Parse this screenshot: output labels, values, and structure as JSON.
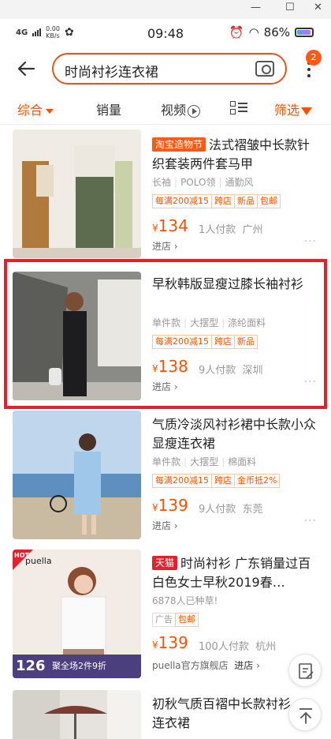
{
  "window_controls": {
    "minimize": "—",
    "maximize": "☐",
    "close": "✕"
  },
  "status_bar": {
    "signal": "4G",
    "net_speed_value": "0.00",
    "net_speed_unit": "KB/s",
    "time": "09:48",
    "battery_percent": "86%"
  },
  "search": {
    "query": "时尚衬衫连衣裙",
    "badge_count": "2"
  },
  "filters": {
    "comprehensive": "综合",
    "sales": "销量",
    "video": "视频",
    "filter": "筛选"
  },
  "products": [
    {
      "shop_tag": "淘宝造物节",
      "title": "法式褶皱中长款针织套装两件套马甲",
      "attrs": [
        "长袖",
        "POLO领",
        "通勤风"
      ],
      "promos": [
        "每满200减15",
        "跨店",
        "新品",
        "包邮"
      ],
      "price": "134",
      "sales": "1人付款",
      "location": "广州",
      "store": "进店"
    },
    {
      "title": "早秋韩版显瘦过膝长袖衬衫",
      "attrs": [
        "单件款",
        "大摆型",
        "涤纶面料"
      ],
      "promos": [
        "每满200减15",
        "跨店",
        "新品"
      ],
      "price": "138",
      "sales": "9人付款",
      "location": "深圳",
      "store": "进店"
    },
    {
      "title": "气质冷淡风衬衫裙中长款小众显瘦连衣裙",
      "attrs": [
        "单件款",
        "大摆型",
        "棉面料"
      ],
      "promos": [
        "每满200减15",
        "跨店",
        "金币抵2%"
      ],
      "price": "139",
      "sales": "9人付款",
      "location": "东莞",
      "store": "进店"
    },
    {
      "shop_tag": "天猫",
      "title": "时尚衬衫 广东销量过百 白色女士早秋2019春…",
      "wishlist": "6878人已种草!",
      "promos": [
        "广告",
        "包邮"
      ],
      "price": "139",
      "sales": "100人付款",
      "location": "杭州",
      "store_name": "puella官方旗舰店",
      "store": "进店",
      "image_band": {
        "brand": "puella",
        "hot": "HOT",
        "price": "126",
        "promo": "聚全场2件9折"
      }
    },
    {
      "title": "初秋气质百褶中长款衬衫连衣裙"
    }
  ],
  "colors": {
    "accent": "#ff5000",
    "tmall_red": "#e5202e",
    "highlight_border": "#e5202e"
  },
  "icons": {
    "back": "back-arrow-icon",
    "camera": "camera-icon",
    "more": "more-vertical-icon",
    "edit": "edit-icon",
    "to_top": "back-to-top-icon"
  }
}
